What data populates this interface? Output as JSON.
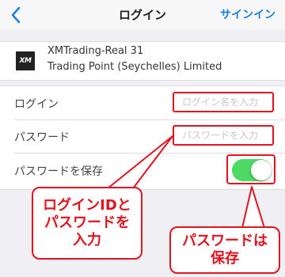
{
  "nav": {
    "back_icon": "chevron-left-icon",
    "title": "ログイン",
    "signin_label": "サインイン",
    "accent_color": "#1a82e2"
  },
  "server": {
    "logo_text": "XM",
    "name": "XMTrading-Real 31",
    "company": "Trading Point (Seychelles) Limited"
  },
  "form": {
    "login_label": "ログイン",
    "login_value": "",
    "login_placeholder": "ログイン名を入力",
    "password_label": "パスワード",
    "password_value": "",
    "password_placeholder": "パスワードを入力",
    "save_password_label": "パスワードを保存",
    "save_password_on": true,
    "toggle_color": "#4cd964"
  },
  "annotations": {
    "color": "#e0131f",
    "callout_input": [
      "ログインIDと",
      "パスワードを",
      "入力"
    ],
    "callout_save": [
      "パスワードは",
      "保存"
    ]
  }
}
